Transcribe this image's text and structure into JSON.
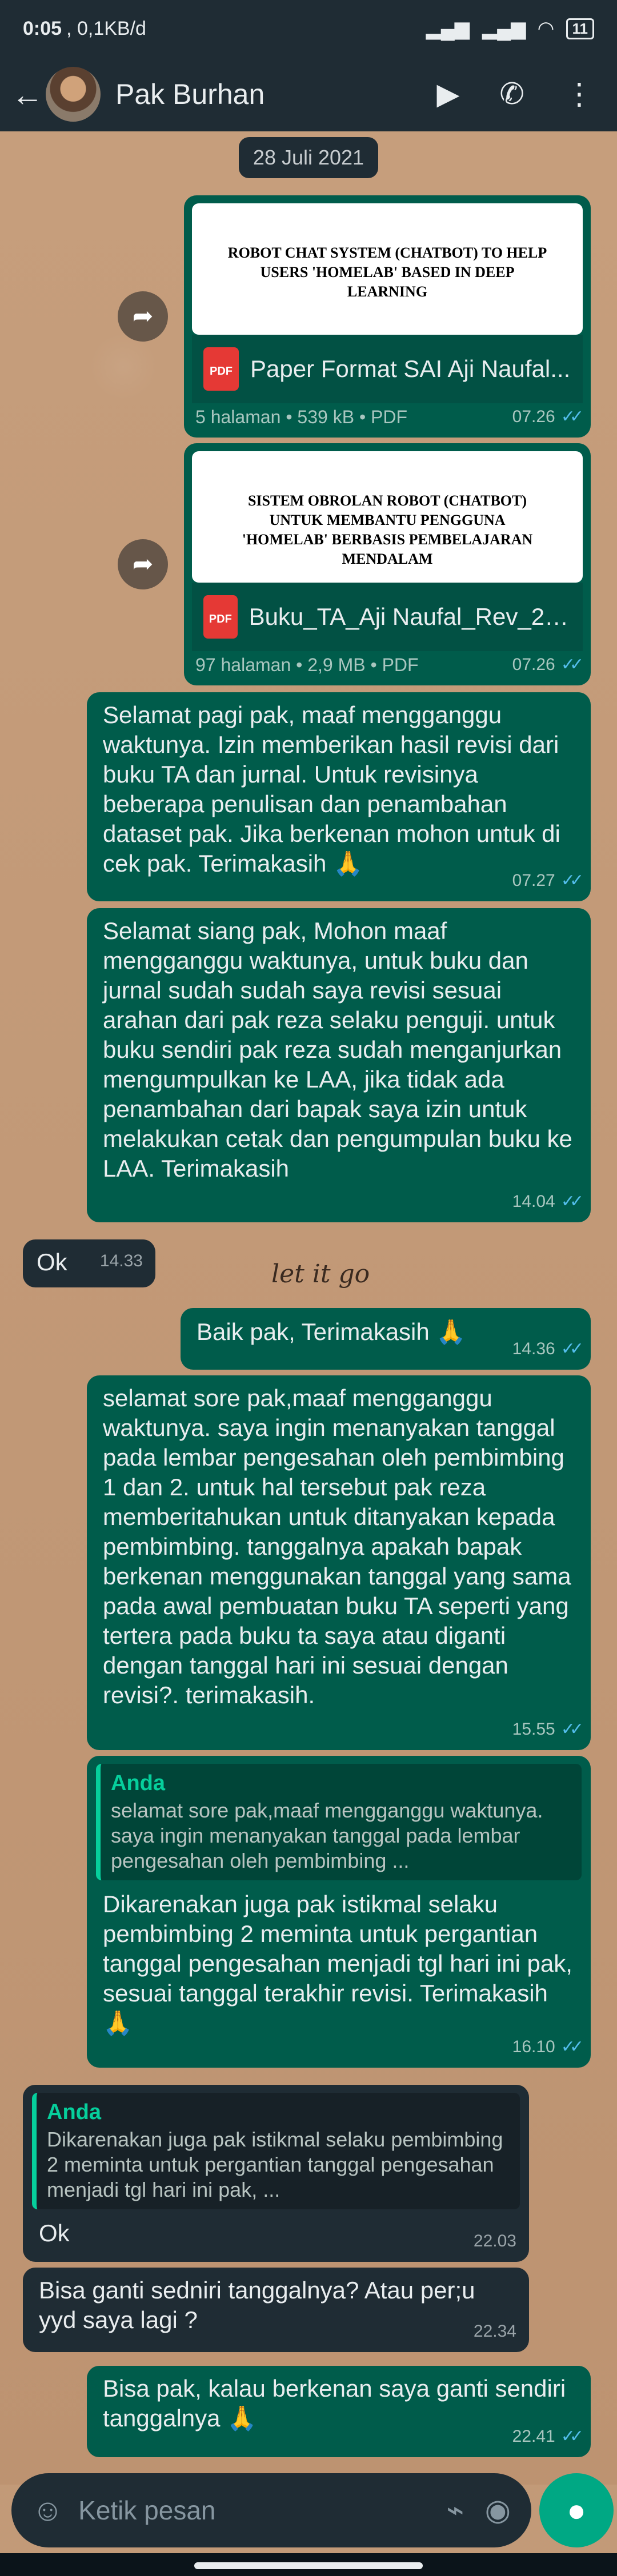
{
  "status_bar": {
    "time": "0:05",
    "speed": "0,1KB/d",
    "battery": "11"
  },
  "header": {
    "contact_name": "Pak Burhan"
  },
  "chat": {
    "date": "28 Juli 2021",
    "documents": [
      {
        "preview_title": "ROBOT CHAT SYSTEM (CHATBOT) TO HELP USERS 'HOMELAB' BASED IN DEEP LEARNING",
        "file_name": "Paper Format SAI Aji Naufal...",
        "info": "5 halaman • 539 kB • PDF",
        "time": "07.26"
      },
      {
        "preview_title": "SISTEM OBROLAN ROBOT (CHATBOT) UNTUK MEMBANTU PENGGUNA 'HOMELAB' BERBASIS PEMBELAJARAN MENDALAM",
        "file_name": "Buku_TA_Aji Naufal_Rev_2.p...",
        "info": "97 halaman • 2,9 MB • PDF",
        "time": "07.26"
      }
    ],
    "messages": [
      {
        "text": "Selamat pagi pak, maaf mengganggu waktunya. Izin memberikan hasil revisi dari buku TA dan jurnal. Untuk revisinya beberapa penulisan dan penambahan dataset pak. Jika berkenan mohon untuk di cek pak. Terimakasih 🙏",
        "time": "07.27"
      },
      {
        "text": "Selamat siang pak, Mohon maaf mengganggu waktunya, untuk buku dan jurnal sudah sudah saya revisi sesuai arahan dari pak reza selaku penguji. untuk buku sendiri pak reza sudah menganjurkan mengumpulkan ke LAA, jika tidak ada penambahan dari bapak saya izin untuk melakukan cetak dan pengumpulan buku ke LAA. Terimakasih",
        "time": "14.04"
      },
      {
        "text": "Ok",
        "time": "14.33"
      },
      {
        "text": "Baik pak, Terimakasih 🙏",
        "time": "14.36"
      },
      {
        "text": "selamat sore pak,maaf mengganggu waktunya. saya ingin menanyakan tanggal pada lembar pengesahan oleh pembimbing 1 dan 2. untuk hal tersebut pak reza memberitahukan untuk ditanyakan kepada pembimbing. tanggalnya apakah bapak berkenan menggunakan tanggal yang sama pada awal pembuatan buku TA seperti yang tertera pada buku ta saya atau diganti dengan tanggal hari ini sesuai dengan revisi?. terimakasih.",
        "time": "15.55"
      },
      {
        "quote_author": "Anda",
        "quote_text": "selamat sore pak,maaf mengganggu waktunya. saya ingin menanyakan tanggal pada lembar pengesahan oleh pembimbing ...",
        "text": "Dikarenakan juga pak istikmal selaku pembimbing 2 meminta untuk pergantian tanggal pengesahan menjadi tgl hari ini pak, sesuai tanggal terakhir revisi. Terimakasih 🙏",
        "time": "16.10"
      },
      {
        "quote_author": "Anda",
        "quote_text": "Dikarenakan juga pak istikmal selaku pembimbing 2 meminta untuk pergantian tanggal pengesahan menjadi tgl hari ini pak, ...",
        "text": "Ok",
        "time": "22.03"
      },
      {
        "text": "Bisa ganti sedniri tanggalnya? Atau per;u yyd saya lagi ?",
        "time": "22.34"
      },
      {
        "text": "Bisa pak, kalau berkenan saya ganti sendiri tanggalnya 🙏",
        "time": "22.41"
      }
    ],
    "sticker_text": "let it go"
  },
  "composer": {
    "placeholder": "Ketik pesan"
  }
}
